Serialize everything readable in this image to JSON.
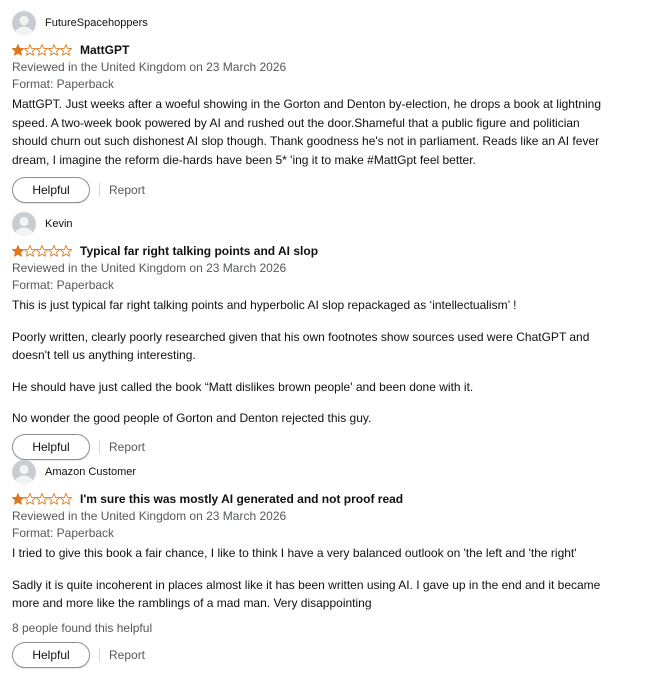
{
  "colors": {
    "star": "#de7921",
    "text": "#0f1111",
    "muted": "#565959"
  },
  "reviews": [
    {
      "author": "FutureSpacehoppers",
      "rating": 1,
      "title": "MattGPT",
      "meta": "Reviewed in the United Kingdom on 23 March 2026",
      "format": "Format: Paperback",
      "paragraphs": [
        "MattGPT. Just weeks after a woeful showing in the Gorton and Denton by-election, he drops a book at lightning speed. A two-week book powered by AI and rushed out the door.Shameful that a public figure and politician should churn out such dishonest AI slop though. Thank goodness he's not in parliament. Reads like an AI fever dream, I imagine the reform die-hards have been 5* 'ing it to make #MattGpt feel better."
      ],
      "helpful_label": "Helpful",
      "report_label": "Report"
    },
    {
      "author": "Kevin",
      "rating": 1,
      "title": "Typical far right talking points and AI slop",
      "meta": "Reviewed in the United Kingdom on 23 March 2026",
      "format": "Format: Paperback",
      "paragraphs": [
        "This is just typical far right talking points and hyperbolic AI slop repackaged as ‘intellectualism’ !",
        "Poorly written, clearly poorly researched given that his own footnotes show sources used were ChatGPT and doesn't tell us anything interesting.",
        "He should have just called the book “Matt dislikes brown people' and been done with it.",
        "No wonder the good people of Gorton and Denton rejected this guy."
      ],
      "helpful_label": "Helpful",
      "report_label": "Report"
    },
    {
      "author": "Amazon Customer",
      "rating": 1,
      "title": "I'm sure this was mostly AI generated and not proof read",
      "meta": "Reviewed in the United Kingdom on 23 March 2026",
      "format": "Format: Paperback",
      "paragraphs": [
        "I tried to give this book a fair chance, I like to think I have a very balanced outlook on 'the left and 'the right'",
        "Sadly it is quite incoherent in places almost like it has been written using AI. I gave up in the end and it became more and more like the ramblings of a mad man. Very disappointing"
      ],
      "found_helpful": "8 people found this helpful",
      "helpful_label": "Helpful",
      "report_label": "Report"
    }
  ]
}
